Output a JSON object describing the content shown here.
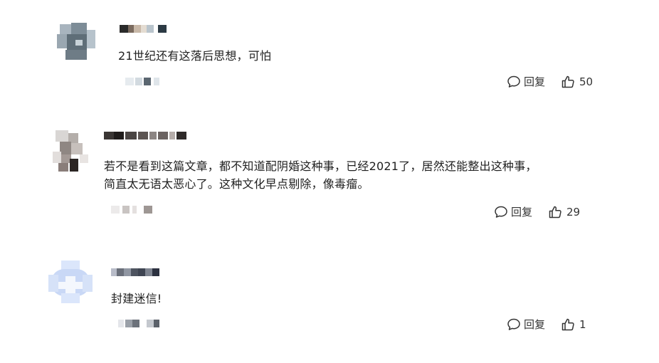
{
  "comments": [
    {
      "text_lines": [
        "21世纪还有这落后思想，可怕"
      ],
      "reply_label": "回复",
      "like_count": "50"
    },
    {
      "text_lines": [
        "若不是看到这篇文章，都不知道配阴婚这种事，已经2021了，居然还能整出这种事，",
        "简直太无语太恶心了。这种文化早点剔除，像毒瘤。"
      ],
      "reply_label": "回复",
      "like_count": "29"
    },
    {
      "text_lines": [
        "封建迷信!"
      ],
      "reply_label": "回复",
      "like_count": "1"
    }
  ],
  "icons": {
    "reply": "comment-bubble-icon",
    "like": "thumbs-up-icon"
  },
  "colors": {
    "text": "#1f1f1f",
    "action": "#333333",
    "background": "#ffffff"
  }
}
